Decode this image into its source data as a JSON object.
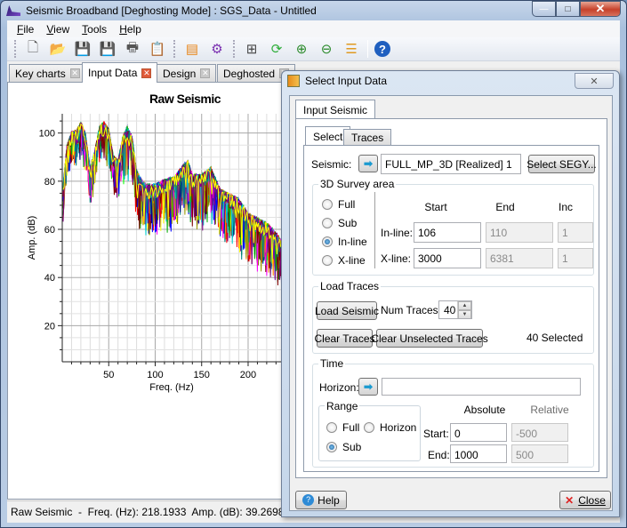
{
  "window": {
    "title": "Seismic Broadband [Deghosting Mode] : SGS_Data - Untitled",
    "controls": {
      "minimize": "—",
      "maximize": "□",
      "close": "✕"
    }
  },
  "menu": [
    {
      "label": "File",
      "accel": "F"
    },
    {
      "label": "View",
      "accel": "V"
    },
    {
      "label": "Tools",
      "accel": "T"
    },
    {
      "label": "Help",
      "accel": "H"
    }
  ],
  "toolbar": {
    "icons": [
      {
        "name": "new-file-icon",
        "glyph": "🗋",
        "color": "#555555"
      },
      {
        "name": "open-folder-icon",
        "glyph": "📂",
        "color": "#e8a33a"
      },
      {
        "name": "save-icon",
        "glyph": "💾",
        "color": "#333333"
      },
      {
        "name": "save-as-icon",
        "glyph": "💾",
        "color": "#6a2fb0"
      },
      {
        "name": "print-icon",
        "glyph": "🖶",
        "color": "#555555"
      },
      {
        "name": "report-icon",
        "glyph": "📋",
        "color": "#777777"
      },
      {
        "name": "seismic-icon",
        "glyph": "▤",
        "color": "#e8861a"
      },
      {
        "name": "settings-gears-icon",
        "glyph": "⚙",
        "color": "#7a2fb0"
      },
      {
        "name": "grid-layout-icon",
        "glyph": "⊞",
        "color": "#444444"
      },
      {
        "name": "refresh-icon",
        "glyph": "⟳",
        "color": "#2fae3a"
      },
      {
        "name": "zoom-in-icon",
        "glyph": "⊕",
        "color": "#2a8a2a"
      },
      {
        "name": "zoom-out-icon",
        "glyph": "⊖",
        "color": "#2a8a2a"
      },
      {
        "name": "layers-icon",
        "glyph": "☰",
        "color": "#e09a20"
      },
      {
        "name": "help-icon",
        "glyph": "?",
        "color": "#1f5fbf"
      }
    ]
  },
  "tabs": [
    {
      "label": "Key charts",
      "active": false
    },
    {
      "label": "Input Data",
      "active": true
    },
    {
      "label": "Design",
      "active": false
    },
    {
      "label": "Deghosted",
      "active": false
    }
  ],
  "chart_data": {
    "type": "line",
    "title": "Raw Seismic",
    "xlabel": "Freq. (Hz)",
    "ylabel": "Amp. (dB)",
    "xlim": [
      0,
      245
    ],
    "ylim": [
      5,
      108
    ],
    "xticks": [
      50,
      100,
      150,
      200
    ],
    "yticks": [
      20,
      40,
      60,
      80,
      100
    ],
    "grid": true,
    "series_count": 40,
    "envelope": {
      "x": [
        1,
        5,
        10,
        15,
        20,
        25,
        30,
        35,
        40,
        45,
        50,
        55,
        60,
        65,
        70,
        75,
        80,
        85,
        90,
        100,
        110,
        120,
        130,
        135,
        140,
        150,
        160,
        170,
        180,
        190,
        200,
        210,
        220,
        230,
        240
      ],
      "y": [
        78,
        94,
        100,
        100,
        104,
        99,
        85,
        92,
        102,
        104,
        101,
        90,
        88,
        98,
        102,
        98,
        84,
        80,
        78,
        78,
        80,
        81,
        86,
        88,
        82,
        82,
        85,
        76,
        74,
        72,
        66,
        64,
        62,
        58,
        52
      ]
    },
    "colors": [
      "#ff0000",
      "#00aa00",
      "#0000ff",
      "#ff00ff",
      "#00cccc",
      "#999900",
      "#800000",
      "#008080",
      "#800080",
      "#ffff00",
      "#00ff00",
      "#000080",
      "#808000",
      "#ff8000",
      "#6a0dad"
    ]
  },
  "statusbar": {
    "text": "Raw Seismic  -  Freq. (Hz): 218.1933  Amp. (dB): 39.2698"
  },
  "dialog": {
    "title": "Select Input Data",
    "close_glyph": "✕",
    "page_tab": "Input Seismic",
    "sub_tabs": [
      {
        "label": "Select",
        "active": true
      },
      {
        "label": "Traces",
        "active": false
      }
    ],
    "seismic": {
      "label": "Seismic:",
      "value": "FULL_MP_3D [Realized] 1",
      "select_button": "Select SEGY..."
    },
    "survey": {
      "title": "3D Survey area",
      "options": [
        {
          "label": "Full",
          "checked": false
        },
        {
          "label": "Sub",
          "checked": false
        },
        {
          "label": "In-line",
          "checked": true
        },
        {
          "label": "X-line",
          "checked": false
        }
      ],
      "headers": {
        "start": "Start",
        "end": "End",
        "inc": "Inc"
      },
      "inline": {
        "label": "In-line:",
        "start": "106",
        "end": "110",
        "inc": "1"
      },
      "xline": {
        "label": "X-line:",
        "start": "3000",
        "end": "6381",
        "inc": "1"
      }
    },
    "load": {
      "title": "Load Traces",
      "load_button": "Load Seismic",
      "num_label": "Num Traces:",
      "num_value": "40",
      "clear_button": "Clear Traces",
      "clear_unselected_button": "Clear Unselected Traces",
      "selected_text": "40 Selected"
    },
    "time": {
      "title": "Time",
      "horizon_label": "Horizon:",
      "horizon_value": "",
      "range_title": "Range",
      "range_options": [
        {
          "label": "Full",
          "checked": false
        },
        {
          "label": "Horizon",
          "checked": false
        },
        {
          "label": "Sub",
          "checked": true
        }
      ],
      "abs_header": "Absolute",
      "rel_header": "Relative",
      "start_label": "Start:",
      "start_abs": "0",
      "start_rel": "-500",
      "end_label": "End:",
      "end_abs": "1000",
      "end_rel": "500"
    },
    "help_button": "Help",
    "close_button": "Close"
  }
}
